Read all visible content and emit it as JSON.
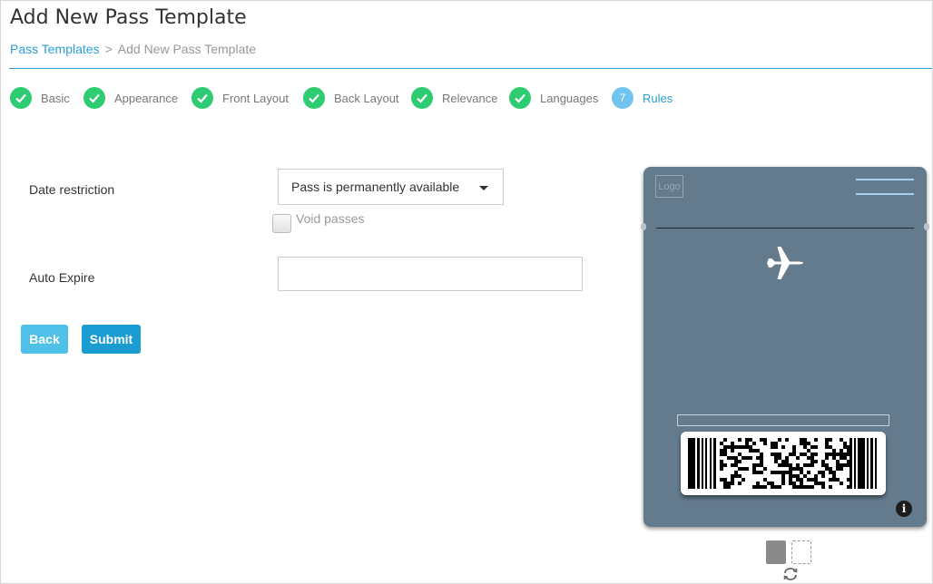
{
  "header": {
    "title": "Add New Pass Template",
    "breadcrumb": {
      "link": "Pass Templates",
      "separator": ">",
      "current": "Add New Pass Template"
    }
  },
  "steps": [
    {
      "label": "Basic",
      "status": "done"
    },
    {
      "label": "Appearance",
      "status": "done"
    },
    {
      "label": "Front Layout",
      "status": "done"
    },
    {
      "label": "Back Layout",
      "status": "done"
    },
    {
      "label": "Relevance",
      "status": "done"
    },
    {
      "label": "Languages",
      "status": "done"
    },
    {
      "label": "Rules",
      "status": "active",
      "number": "7"
    }
  ],
  "form": {
    "date_restriction_label": "Date restriction",
    "date_restriction_value": "Pass is permanently available",
    "void_passes_label": "Void passes",
    "void_passes_checked": false,
    "auto_expire_label": "Auto Expire",
    "auto_expire_value": ""
  },
  "buttons": {
    "back": "Back",
    "submit": "Submit"
  },
  "preview": {
    "logo": "Logo",
    "background_color": "#647a8d",
    "icon": "airplane-icon",
    "barcode_type": "PDF417",
    "info": "i"
  },
  "colors": {
    "accent": "#2a9fd6",
    "done": "#2ecc71",
    "active_step": "#72c4f0",
    "submit": "#1b9dd3",
    "back": "#4fc0e8"
  }
}
